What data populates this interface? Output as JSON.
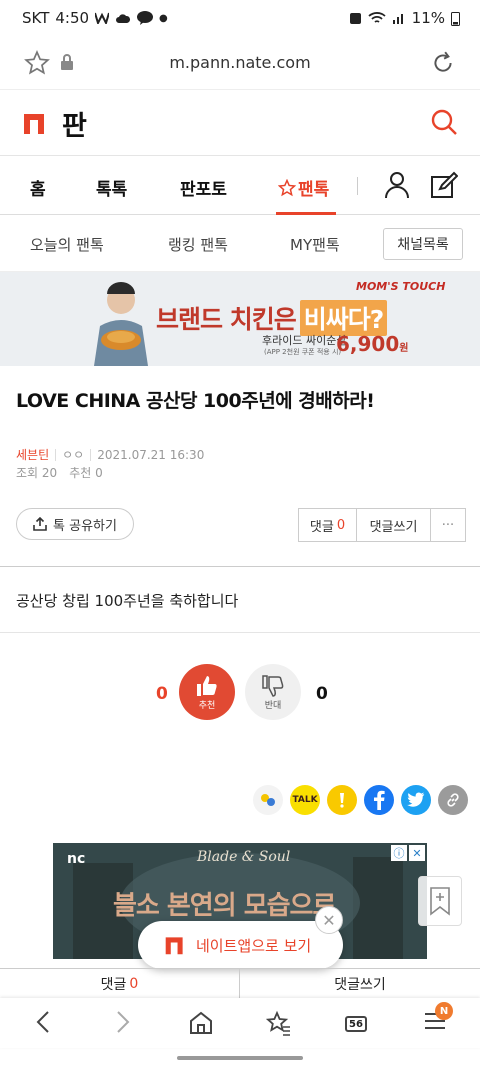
{
  "status_bar": {
    "carrier": "SKT",
    "time": "4:50",
    "battery": "11%"
  },
  "browser": {
    "url": "m.pann.nate.com"
  },
  "site": {
    "title": "판"
  },
  "main_nav": {
    "tabs": [
      "홈",
      "톡톡",
      "판포토",
      "팬톡"
    ],
    "active_tab": "팬톡"
  },
  "sub_nav": {
    "tabs": [
      "오늘의 팬톡",
      "랭킹 팬톡",
      "MY팬톡"
    ],
    "channel_button": "채널목록"
  },
  "banner_ad": {
    "brand": "MOM'S TOUCH",
    "headline_part1": "브랜드 치킨은",
    "headline_highlight": "비싸다?",
    "product": "후라이드 싸이순살",
    "note": "(APP 2천원 쿠폰 적용 시)",
    "price": "6,900",
    "price_unit": "원"
  },
  "post": {
    "title": "LOVE CHINA 공산당 100주년에 경배하라!",
    "author": "세븐틴",
    "nickname": "ㅇㅇ",
    "datetime": "2021.07.21 16:30",
    "views_label": "조회",
    "views": "20",
    "likes_label": "추천",
    "likes": "0",
    "body": "공산당 창립 100주년을 축하합니다"
  },
  "actions": {
    "share_label": "톡 공유하기",
    "comment_label": "댓글",
    "comment_count": "0",
    "write_comment_label": "댓글쓰기",
    "more": "···"
  },
  "vote": {
    "up_count": "0",
    "up_label": "추천",
    "down_count": "0",
    "down_label": "반대"
  },
  "sns": {
    "talk_label": "TALK"
  },
  "ad2": {
    "brand": "nc",
    "game": "Blade & Soul",
    "text": "블소 본연의 모습으로"
  },
  "app_banner": {
    "label": "네이트앱으로 보기"
  },
  "bottom_bar": {
    "comment_label": "댓글",
    "comment_count": "0",
    "write_label": "댓글쓰기"
  },
  "browser_nav": {
    "tabs_count": "56",
    "menu_badge": "N"
  },
  "colors": {
    "accent": "#e8432a",
    "kakao": "#f9df00",
    "facebook": "#1877f2",
    "twitter": "#1da1f2"
  }
}
